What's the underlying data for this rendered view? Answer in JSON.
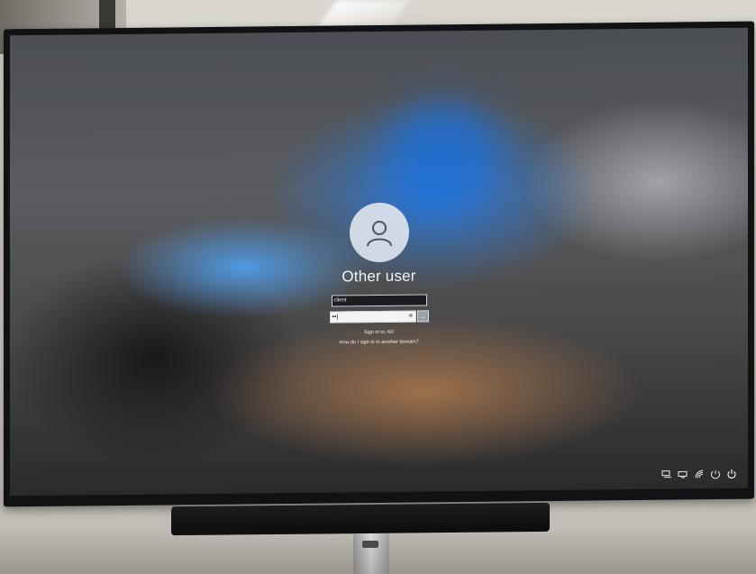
{
  "lock_screen": {
    "user_name": "Other user",
    "username_field_value": "client",
    "password_field_value": "••|",
    "password_reveal_glyph": "◉",
    "submit_glyph": "→",
    "sign_in_to": "Sign in to: AD",
    "domain_help_link": "How do I sign in to another domain?"
  },
  "tray_icons": [
    "network-icon",
    "accessibility-icon",
    "wifi-icon",
    "ease-of-access-icon",
    "power-icon"
  ],
  "colors": {
    "accent_blue": "#2878dc",
    "text_light": "#f2f4f8",
    "field_dark": "#1c1d20"
  }
}
